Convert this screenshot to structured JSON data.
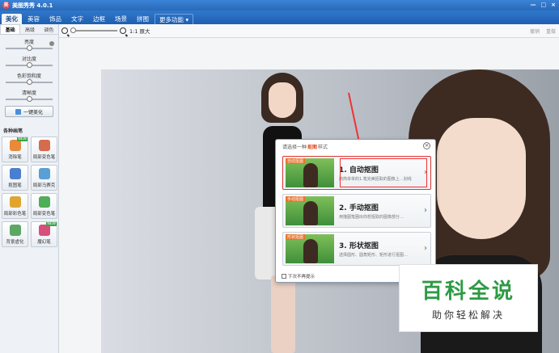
{
  "app": {
    "title": "美图秀秀 4.0.1",
    "window_controls": [
      "—",
      "□",
      "×"
    ]
  },
  "menu": {
    "tabs": [
      {
        "label": "美化",
        "active": true
      },
      {
        "label": "美容",
        "active": false
      },
      {
        "label": "饰品",
        "active": false
      },
      {
        "label": "文字",
        "active": false
      },
      {
        "label": "边框",
        "active": false
      },
      {
        "label": "场景",
        "active": false
      },
      {
        "label": "拼图",
        "active": false
      },
      {
        "label": "更多功能 ▾",
        "active": false
      }
    ]
  },
  "toolbar": {
    "zoom_label": "1:1 原大",
    "undo_label": "撤销",
    "redo_label": "重做"
  },
  "left": {
    "subtabs": [
      "基础",
      "高级",
      "调色"
    ],
    "adjustments": [
      "亮度",
      "对比度",
      "色彩饱和度",
      "清晰度"
    ],
    "onekey_label": "一键美化",
    "brush_title": "各种画笔",
    "brushes": [
      {
        "label": "消除笔",
        "color": "#e98a3b",
        "new": true
      },
      {
        "label": "局部变色笔",
        "color": "#d66b4e",
        "new": false
      },
      {
        "label": "抠图笔",
        "color": "#4a7fd0",
        "new": false
      },
      {
        "label": "局部马赛克",
        "color": "#5a9fd6",
        "new": false
      },
      {
        "label": "局部彩色笔",
        "color": "#e0a530",
        "new": false
      },
      {
        "label": "局部变色笔",
        "color": "#4fae57",
        "new": false
      },
      {
        "label": "背景虚化",
        "color": "#5aa864",
        "new": false
      },
      {
        "label": "魔幻笔",
        "color": "#d84f7b",
        "new": true
      }
    ],
    "new_tag": "NEW"
  },
  "dialog": {
    "header_prefix": "请选择一种",
    "header_highlight": "抠图",
    "header_suffix": "样式",
    "close_label": "×",
    "options": [
      {
        "tag": "自动抠图",
        "title": "1. 自动抠图",
        "desc": "简简单单的1.笔完美抠取的图像上…划线",
        "selected": true
      },
      {
        "tag": "手动抠图",
        "title": "2. 手动抠图",
        "desc": "用描图笔圈出你想抠取的图像部分…",
        "selected": false
      },
      {
        "tag": "形状抠图",
        "title": "3. 形状抠图",
        "desc": "选择圆形、圆角矩形、矩形进行抠图…",
        "selected": false
      }
    ],
    "footer_label": "下次不再提示"
  },
  "watermark": {
    "main": "百科全说",
    "sub": "助你轻松解决"
  }
}
